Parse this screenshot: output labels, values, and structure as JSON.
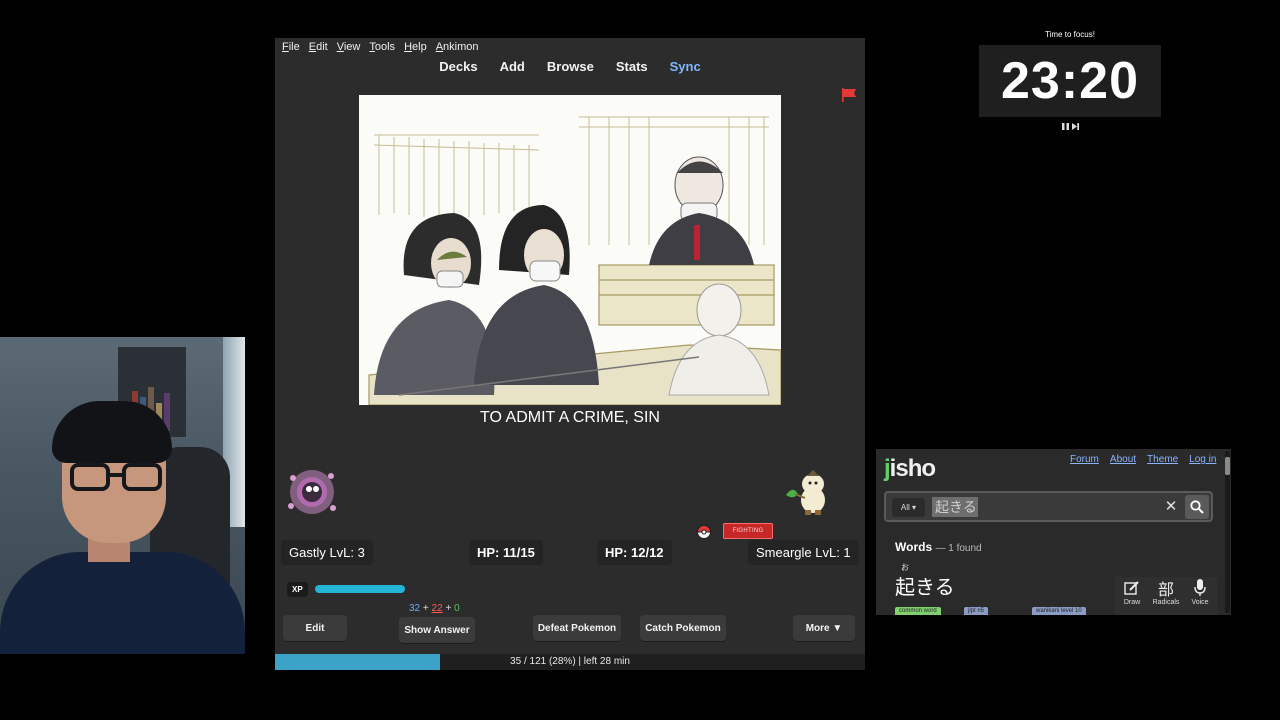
{
  "anki": {
    "menu": [
      "File",
      "Edit",
      "View",
      "Tools",
      "Help",
      "Ankimon"
    ],
    "nav": {
      "decks": "Decks",
      "add": "Add",
      "browse": "Browse",
      "stats": "Stats",
      "sync": "Sync"
    },
    "card": {
      "definition": "TO ADMIT A CRIME, SIN"
    },
    "battle": {
      "player": {
        "label": "Gastly LvL: 3",
        "hp": "HP: 11/15"
      },
      "enemy": {
        "label": "Smeargle LvL: 1",
        "hp": "HP: 12/12",
        "type": "FIGHTING"
      },
      "xp_label": "XP",
      "xp_fraction": 0.29
    },
    "counts": {
      "new": "32",
      "plus1": "+",
      "learn": "22",
      "plus2": "+",
      "review": "0"
    },
    "buttons": {
      "edit": "Edit",
      "show_answer": "Show Answer",
      "defeat": "Defeat Pokemon",
      "catch": "Catch Pokemon",
      "more": "More ▼"
    },
    "progress": {
      "text": "35 / 121 (28%) | left 28 min",
      "fraction": 0.28
    },
    "colors": {
      "accent": "#7fb6ff",
      "progress": "#3aa3c7",
      "xp": "#23b4d8",
      "flag": "#e53935"
    }
  },
  "timer": {
    "caption": "Time to focus!",
    "time": "23:20"
  },
  "jisho": {
    "logo_j": "j",
    "logo_rest": "isho",
    "links": [
      "Forum",
      "About",
      "Theme",
      "Log in"
    ],
    "search": {
      "scope": "All ▾",
      "value": "起きる"
    },
    "results": {
      "heading": "Words",
      "found": "— 1 found",
      "furigana": "お",
      "word": "起きる"
    },
    "tags": [
      "common word",
      "jlpt n5",
      "wanikani level 10"
    ],
    "tools": [
      {
        "icon": "draw-icon",
        "label": "Draw"
      },
      {
        "icon": "radicals-icon",
        "glyph": "部",
        "label": "Radicals"
      },
      {
        "icon": "microphone-icon",
        "label": "Voice"
      }
    ]
  }
}
